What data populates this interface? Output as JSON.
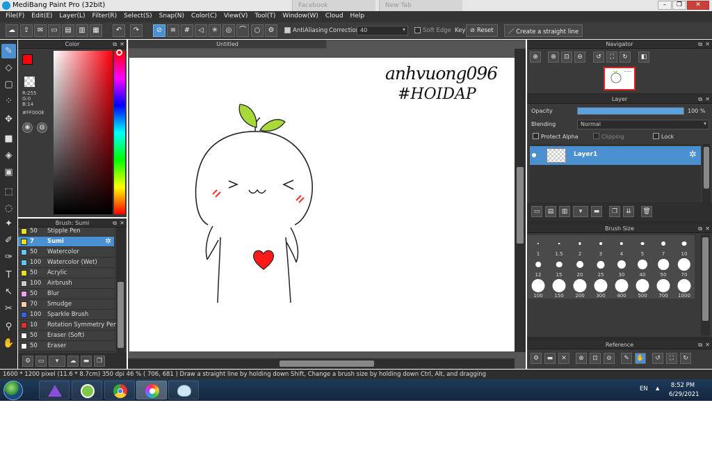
{
  "window": {
    "title": "MediBang Paint Pro (32bit)",
    "ghost_tab_1": "Facebook",
    "ghost_tab_2": "New Tab"
  },
  "menu": [
    "File(F)",
    "Edit(E)",
    "Layer(L)",
    "Filter(R)",
    "Select(S)",
    "Snap(N)",
    "Color(C)",
    "View(V)",
    "Tool(T)",
    "Window(W)",
    "Cloud",
    "Help"
  ],
  "toolbar": {
    "antialiasing_label": "AntiAliasing",
    "correction_label": "Correction",
    "correction_value": "40",
    "soft_edge_label": "Soft Edge",
    "key_label": "Key",
    "reset_label": "Reset",
    "straight_line_label": "Create a straight line"
  },
  "color_panel": {
    "title": "Color",
    "r": "R:255",
    "g": "G:0",
    "b": "B:14",
    "hex": "#FF000E",
    "primary_color": "#ff000e"
  },
  "brush_panel": {
    "title": "Brush: Sumi",
    "brushes": [
      {
        "size": "50",
        "name": "Stipple Pen",
        "color": "#e8e020"
      },
      {
        "size": "7",
        "name": "Sumi",
        "color": "#e8e020",
        "selected": true
      },
      {
        "size": "50",
        "name": "Watercolor",
        "color": "#5fc8f0"
      },
      {
        "size": "100",
        "name": "Watercolor (Wet)",
        "color": "#5fc8f0"
      },
      {
        "size": "50",
        "name": "Acrylic",
        "color": "#e8e020"
      },
      {
        "size": "100",
        "name": "Airbrush",
        "color": "#cccccc"
      },
      {
        "size": "50",
        "name": "Blur",
        "color": "#f2a0f0"
      },
      {
        "size": "70",
        "name": "Smudge",
        "color": "#f5cfa8"
      },
      {
        "size": "100",
        "name": "Sparkle Brush",
        "color": "#3a5fe0"
      },
      {
        "size": "10",
        "name": "Rotation Symmetry Pen",
        "color": "#e03030"
      },
      {
        "size": "50",
        "name": "Eraser (Soft)",
        "color": "#ffffff"
      },
      {
        "size": "50",
        "name": "Eraser",
        "color": "#ffffff"
      }
    ]
  },
  "canvas": {
    "tab_title": "Untitled",
    "watermark_line1": "anhvuong096",
    "watermark_line2": "#HOIDAP"
  },
  "navigator": {
    "title": "Navigator"
  },
  "layer_panel": {
    "title": "Layer",
    "opacity_label": "Opacity",
    "opacity_value": "100 %",
    "opacity_fraction": 1.0,
    "blending_label": "Blending",
    "blending_value": "Normal",
    "protect_alpha_label": "Protect Alpha",
    "clipping_label": "Clipping",
    "lock_label": "Lock",
    "layer_name": "Layer1"
  },
  "brush_size_panel": {
    "title": "Brush Size",
    "sizes": [
      "1",
      "1.5",
      "2",
      "3",
      "4",
      "5",
      "7",
      "10",
      "12",
      "15",
      "20",
      "25",
      "30",
      "40",
      "50",
      "70",
      "100",
      "150",
      "200",
      "300",
      "400",
      "500",
      "700",
      "1000"
    ]
  },
  "reference_panel": {
    "title": "Reference"
  },
  "status_bar": {
    "dimensions": "1600 * 1200 pixel",
    "physical": "(11.6 * 8.7cm)",
    "dpi": "350 dpi",
    "zoom": "46 %",
    "cursor": "( 706, 681 )",
    "hint": "Draw a straight line by holding down Shift, Change a brush size by holding down Ctrl, Alt, and dragging"
  },
  "taskbar": {
    "language": "EN",
    "time": "8:52 PM",
    "date": "6/29/2021"
  }
}
